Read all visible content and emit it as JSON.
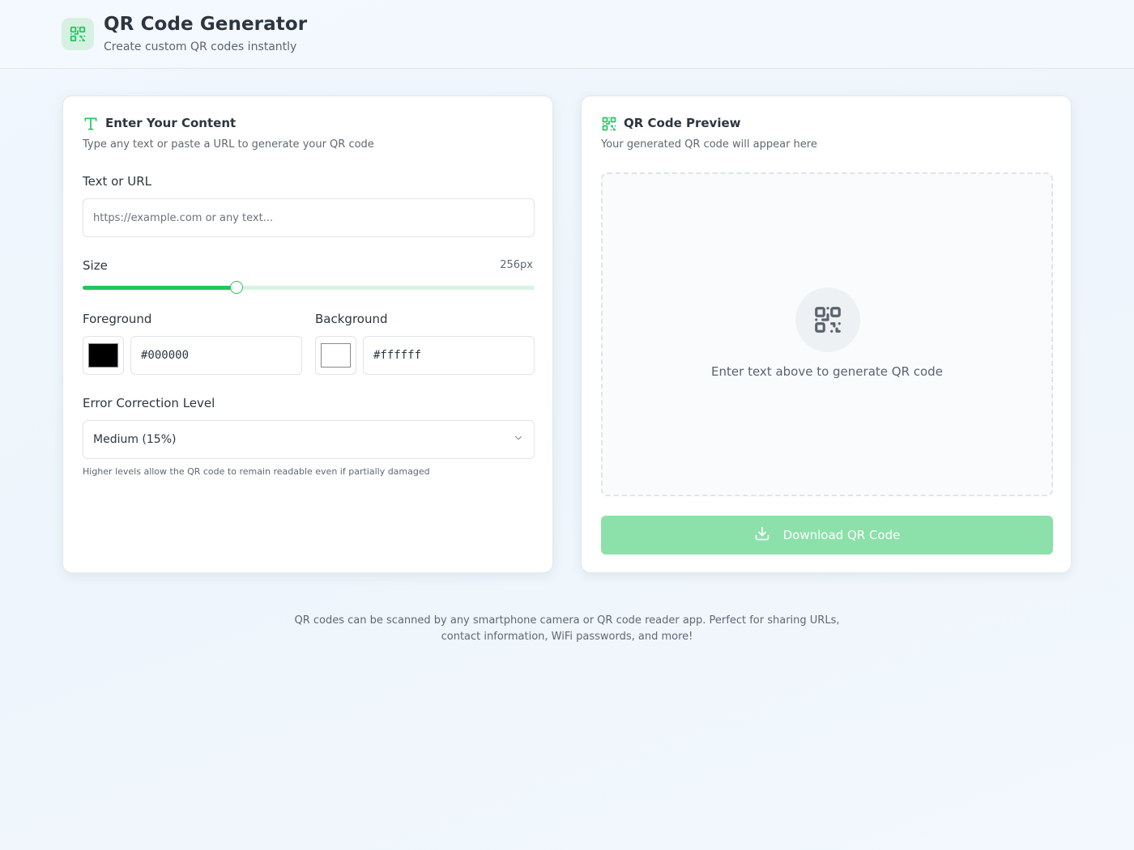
{
  "app": {
    "title": "QR Code Generator",
    "subtitle": "Create custom QR codes instantly",
    "logo_icon": "qr-code-icon"
  },
  "content_card": {
    "title": "Enter Your Content",
    "title_icon": "text-type-icon",
    "description": "Type any text or paste a URL to generate your QR code",
    "text_label": "Text or URL",
    "text_value": "",
    "text_placeholder": "https://example.com or any text...",
    "size_label": "Size",
    "size_value": "256px",
    "size_slider_fraction": 0.34,
    "foreground_label": "Foreground",
    "foreground_value": "#000000",
    "background_label": "Background",
    "background_value": "#ffffff",
    "error_label": "Error Correction Level",
    "error_selected": "Medium (15%)",
    "error_hint": "Higher levels allow the QR code to remain readable even if partially damaged"
  },
  "preview_card": {
    "title": "QR Code Preview",
    "title_icon": "qr-code-icon",
    "description": "Your generated QR code will appear here",
    "empty_message": "Enter text above to generate QR code",
    "download_label": "Download QR Code",
    "download_icon": "download-icon"
  },
  "footer": {
    "line1": "QR codes can be scanned by any smartphone camera or QR code reader app. Perfect for sharing URLs,",
    "line2": "contact information, WiFi passwords, and more!"
  },
  "colors": {
    "accent": "#22c55e",
    "accent_disabled": "#8ce0a9",
    "page_bg": "#f0f7fd"
  }
}
